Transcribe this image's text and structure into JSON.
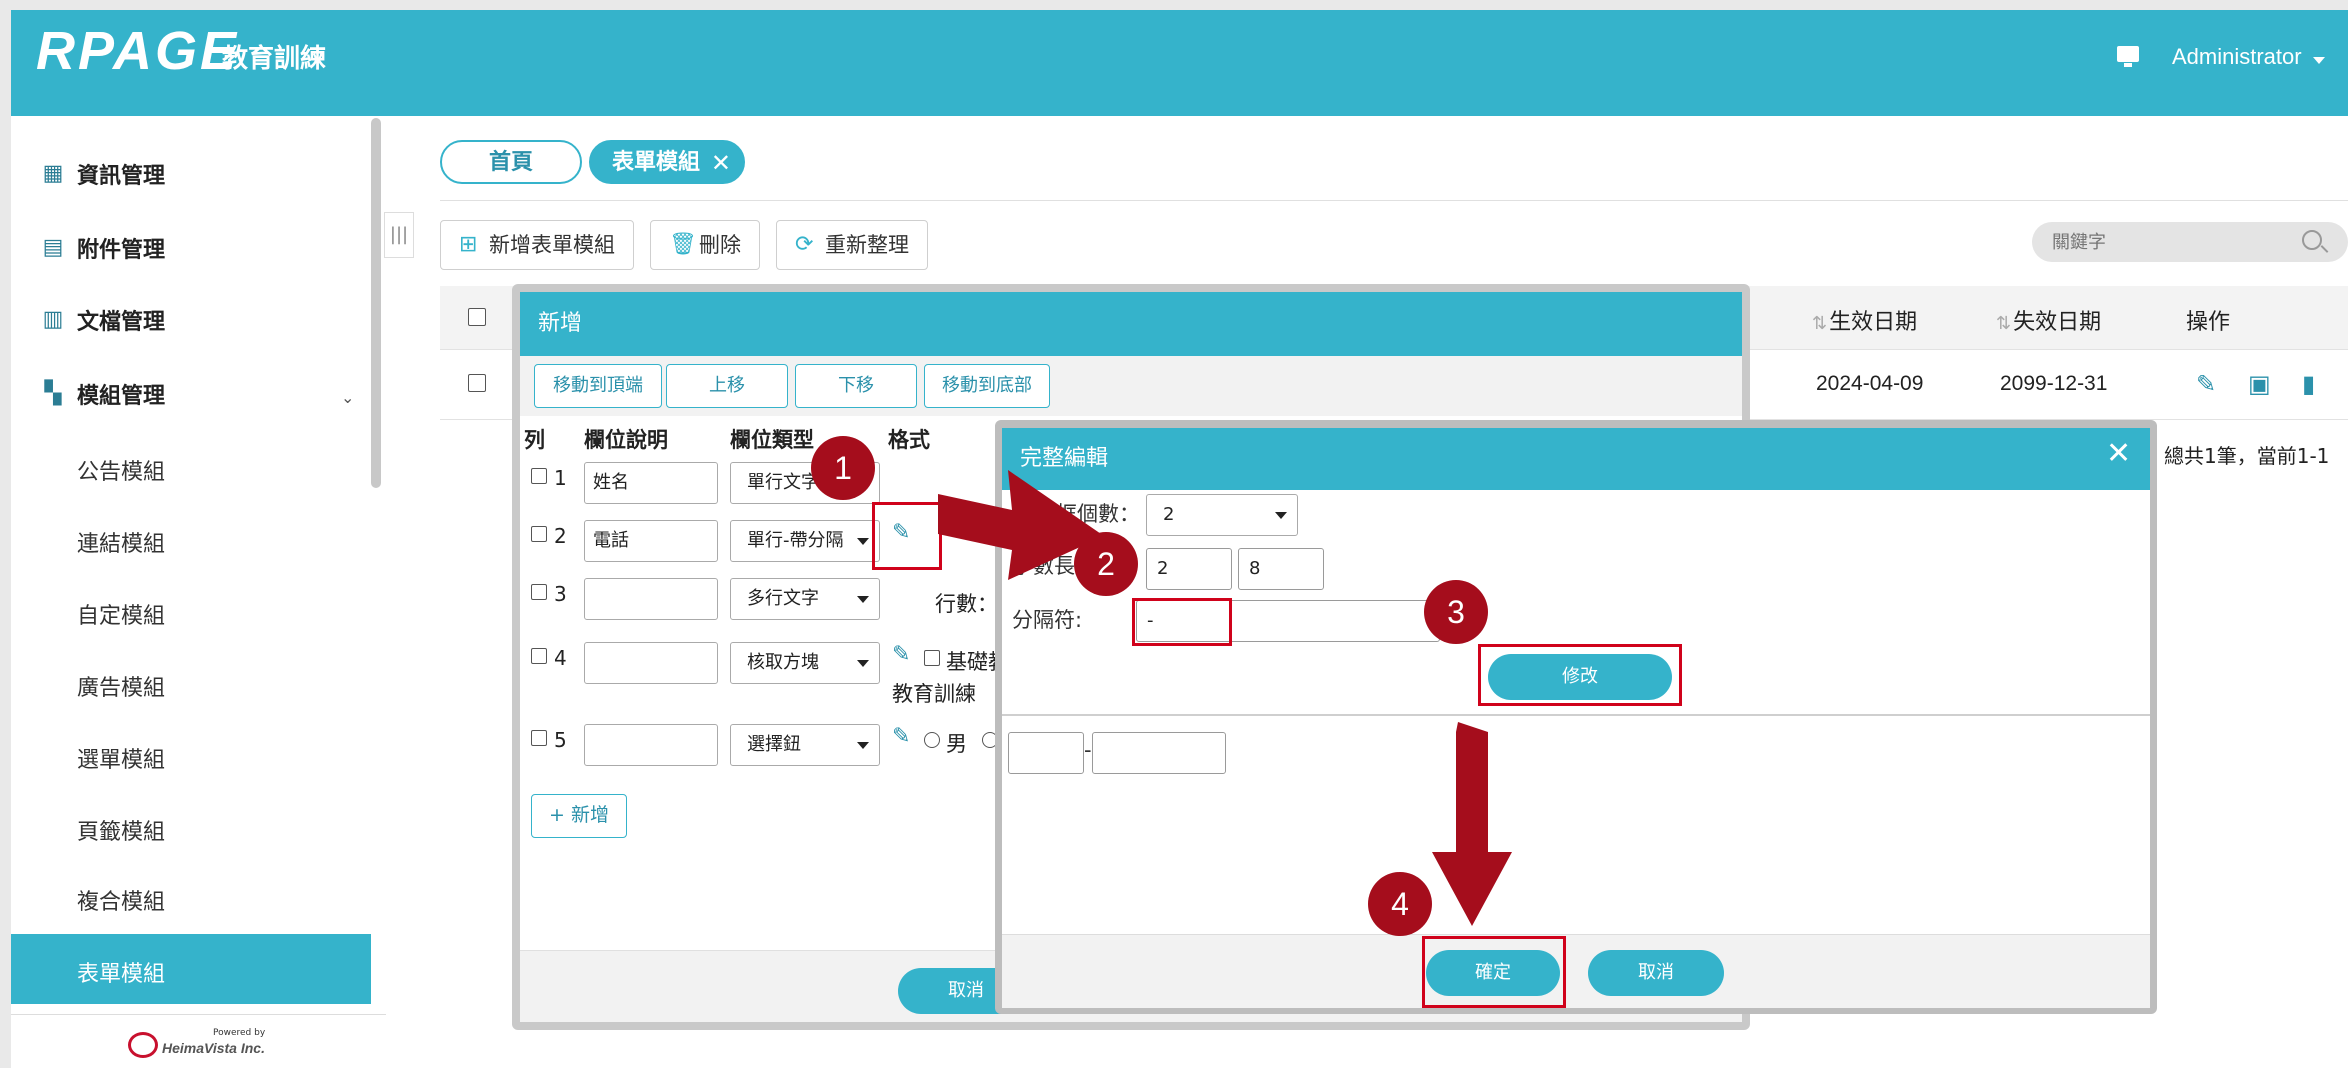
{
  "header": {
    "brand": "RPAGE",
    "subtitle": "教育訓練",
    "user": "Administrator"
  },
  "sidebar": {
    "items": [
      {
        "label": "資訊管理",
        "icon": "dashboard-icon"
      },
      {
        "label": "附件管理",
        "icon": "attachment-icon"
      },
      {
        "label": "文檔管理",
        "icon": "chart-icon"
      },
      {
        "label": "模組管理",
        "icon": "grid-icon"
      }
    ],
    "submodules": [
      "公告模組",
      "連結模組",
      "自定模組",
      "廣告模組",
      "選單模組",
      "頁籤模組",
      "複合模組",
      "表單模組"
    ],
    "footer_small": "Powered by",
    "footer_brand": "HeimaVista Inc."
  },
  "tabs": {
    "home": "首頁",
    "active": "表單模組"
  },
  "toolbar": {
    "add": "新增表單模組",
    "delete": "刪除",
    "refresh": "重新整理"
  },
  "search": {
    "placeholder": "關鍵字"
  },
  "grid": {
    "headers": {
      "effective": "生效日期",
      "expiry": "失效日期",
      "actions": "操作"
    },
    "row": {
      "effective": "2024-04-09",
      "expiry": "2099-12-31"
    },
    "pager": "總共1筆，當前1-1"
  },
  "dialog_new": {
    "title": "新增",
    "move_buttons": [
      "移動到頂端",
      "上移",
      "下移",
      "移動到底部"
    ],
    "columns": {
      "col": "列",
      "desc": "欄位說明",
      "type": "欄位類型",
      "format": "格式"
    },
    "rows": [
      {
        "num": "1",
        "desc": "姓名",
        "type": "單行文字"
      },
      {
        "num": "2",
        "desc": "電話",
        "type": "單行-帶分隔"
      },
      {
        "num": "3",
        "desc": "",
        "type": "多行文字"
      },
      {
        "num": "4",
        "desc": "",
        "type": "核取方塊"
      },
      {
        "num": "5",
        "desc": "",
        "type": "選擇鈕"
      }
    ],
    "row3_format": "行數：",
    "row4_format_a": "基礎教",
    "row4_format_b": "教育訓練",
    "row5_format": "男",
    "add_button": "+ 新增",
    "cancel": "取消"
  },
  "dialog_edit": {
    "title": "完整編輯",
    "box_count_label": "框個數：",
    "box_count_value": "2",
    "length_label": "字數長",
    "length_values": [
      "2",
      "8"
    ],
    "separator_label": "分隔符:",
    "separator_value": "-",
    "modify": "修改",
    "preview_sep": "-",
    "confirm": "確定",
    "cancel": "取消"
  },
  "annotations": [
    "1",
    "2",
    "3",
    "4"
  ],
  "colors": {
    "primary": "#35b3cb",
    "annotation": "#a50d1c",
    "highlight": "#d0021b"
  }
}
